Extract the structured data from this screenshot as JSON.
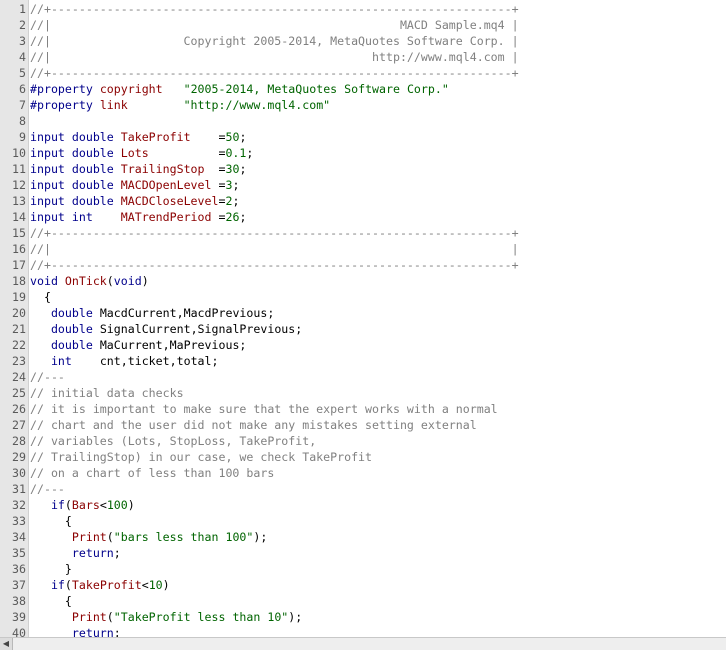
{
  "lines": [
    {
      "n": "1",
      "tokens": [
        {
          "t": "cm",
          "v": "//+------------------------------------------------------------------+"
        }
      ]
    },
    {
      "n": "2",
      "tokens": [
        {
          "t": "cm",
          "v": "//|                                                  MACD Sample.mq4 |"
        }
      ]
    },
    {
      "n": "3",
      "tokens": [
        {
          "t": "cm",
          "v": "//|                   Copyright 2005-2014, MetaQuotes Software Corp. |"
        }
      ]
    },
    {
      "n": "4",
      "tokens": [
        {
          "t": "cm",
          "v": "//|                                              http://www.mql4.com |"
        }
      ]
    },
    {
      "n": "5",
      "tokens": [
        {
          "t": "cm",
          "v": "//+------------------------------------------------------------------+"
        }
      ]
    },
    {
      "n": "6",
      "tokens": [
        {
          "t": "kw",
          "v": "#property"
        },
        {
          "t": "pl",
          "v": " "
        },
        {
          "t": "fn",
          "v": "copyright"
        },
        {
          "t": "pl",
          "v": "   "
        },
        {
          "t": "str",
          "v": "\"2005-2014, MetaQuotes Software Corp.\""
        }
      ]
    },
    {
      "n": "7",
      "tokens": [
        {
          "t": "kw",
          "v": "#property"
        },
        {
          "t": "pl",
          "v": " "
        },
        {
          "t": "fn",
          "v": "link"
        },
        {
          "t": "pl",
          "v": "        "
        },
        {
          "t": "str",
          "v": "\"http://www.mql4.com\""
        }
      ]
    },
    {
      "n": "8",
      "tokens": []
    },
    {
      "n": "9",
      "tokens": [
        {
          "t": "kw",
          "v": "input double"
        },
        {
          "t": "pl",
          "v": " "
        },
        {
          "t": "fn",
          "v": "TakeProfit"
        },
        {
          "t": "pl",
          "v": "    ="
        },
        {
          "t": "num",
          "v": "50"
        },
        {
          "t": "pl",
          "v": ";"
        }
      ]
    },
    {
      "n": "10",
      "tokens": [
        {
          "t": "kw",
          "v": "input double"
        },
        {
          "t": "pl",
          "v": " "
        },
        {
          "t": "fn",
          "v": "Lots"
        },
        {
          "t": "pl",
          "v": "          ="
        },
        {
          "t": "num",
          "v": "0.1"
        },
        {
          "t": "pl",
          "v": ";"
        }
      ]
    },
    {
      "n": "11",
      "tokens": [
        {
          "t": "kw",
          "v": "input double"
        },
        {
          "t": "pl",
          "v": " "
        },
        {
          "t": "fn",
          "v": "TrailingStop"
        },
        {
          "t": "pl",
          "v": "  ="
        },
        {
          "t": "num",
          "v": "30"
        },
        {
          "t": "pl",
          "v": ";"
        }
      ]
    },
    {
      "n": "12",
      "tokens": [
        {
          "t": "kw",
          "v": "input double"
        },
        {
          "t": "pl",
          "v": " "
        },
        {
          "t": "fn",
          "v": "MACDOpenLevel"
        },
        {
          "t": "pl",
          "v": " ="
        },
        {
          "t": "num",
          "v": "3"
        },
        {
          "t": "pl",
          "v": ";"
        }
      ]
    },
    {
      "n": "13",
      "tokens": [
        {
          "t": "kw",
          "v": "input double"
        },
        {
          "t": "pl",
          "v": " "
        },
        {
          "t": "fn",
          "v": "MACDCloseLevel"
        },
        {
          "t": "pl",
          "v": "="
        },
        {
          "t": "num",
          "v": "2"
        },
        {
          "t": "pl",
          "v": ";"
        }
      ]
    },
    {
      "n": "14",
      "tokens": [
        {
          "t": "kw",
          "v": "input int"
        },
        {
          "t": "pl",
          "v": "    "
        },
        {
          "t": "fn",
          "v": "MATrendPeriod"
        },
        {
          "t": "pl",
          "v": " ="
        },
        {
          "t": "num",
          "v": "26"
        },
        {
          "t": "pl",
          "v": ";"
        }
      ]
    },
    {
      "n": "15",
      "tokens": [
        {
          "t": "cm",
          "v": "//+------------------------------------------------------------------+"
        }
      ]
    },
    {
      "n": "16",
      "tokens": [
        {
          "t": "cm",
          "v": "//|                                                                  |"
        }
      ]
    },
    {
      "n": "17",
      "tokens": [
        {
          "t": "cm",
          "v": "//+------------------------------------------------------------------+"
        }
      ]
    },
    {
      "n": "18",
      "tokens": [
        {
          "t": "kw",
          "v": "void"
        },
        {
          "t": "pl",
          "v": " "
        },
        {
          "t": "fn",
          "v": "OnTick"
        },
        {
          "t": "pl",
          "v": "("
        },
        {
          "t": "kw",
          "v": "void"
        },
        {
          "t": "pl",
          "v": ")"
        }
      ]
    },
    {
      "n": "19",
      "tokens": [
        {
          "t": "pl",
          "v": "  {"
        }
      ]
    },
    {
      "n": "20",
      "tokens": [
        {
          "t": "pl",
          "v": "   "
        },
        {
          "t": "kw",
          "v": "double"
        },
        {
          "t": "pl",
          "v": " MacdCurrent,MacdPrevious;"
        }
      ]
    },
    {
      "n": "21",
      "tokens": [
        {
          "t": "pl",
          "v": "   "
        },
        {
          "t": "kw",
          "v": "double"
        },
        {
          "t": "pl",
          "v": " SignalCurrent,SignalPrevious;"
        }
      ]
    },
    {
      "n": "22",
      "tokens": [
        {
          "t": "pl",
          "v": "   "
        },
        {
          "t": "kw",
          "v": "double"
        },
        {
          "t": "pl",
          "v": " MaCurrent,MaPrevious;"
        }
      ]
    },
    {
      "n": "23",
      "tokens": [
        {
          "t": "pl",
          "v": "   "
        },
        {
          "t": "kw",
          "v": "int"
        },
        {
          "t": "pl",
          "v": "    cnt,ticket,total;"
        }
      ]
    },
    {
      "n": "24",
      "tokens": [
        {
          "t": "cm",
          "v": "//---"
        }
      ]
    },
    {
      "n": "25",
      "tokens": [
        {
          "t": "cm",
          "v": "// initial data checks"
        }
      ]
    },
    {
      "n": "26",
      "tokens": [
        {
          "t": "cm",
          "v": "// it is important to make sure that the expert works with a normal"
        }
      ]
    },
    {
      "n": "27",
      "tokens": [
        {
          "t": "cm",
          "v": "// chart and the user did not make any mistakes setting external"
        }
      ]
    },
    {
      "n": "28",
      "tokens": [
        {
          "t": "cm",
          "v": "// variables (Lots, StopLoss, TakeProfit,"
        }
      ]
    },
    {
      "n": "29",
      "tokens": [
        {
          "t": "cm",
          "v": "// TrailingStop) in our case, we check TakeProfit"
        }
      ]
    },
    {
      "n": "30",
      "tokens": [
        {
          "t": "cm",
          "v": "// on a chart of less than 100 bars"
        }
      ]
    },
    {
      "n": "31",
      "tokens": [
        {
          "t": "cm",
          "v": "//---"
        }
      ]
    },
    {
      "n": "32",
      "tokens": [
        {
          "t": "pl",
          "v": "   "
        },
        {
          "t": "kw",
          "v": "if"
        },
        {
          "t": "pl",
          "v": "("
        },
        {
          "t": "fn",
          "v": "Bars"
        },
        {
          "t": "pl",
          "v": "<"
        },
        {
          "t": "num",
          "v": "100"
        },
        {
          "t": "pl",
          "v": ")"
        }
      ]
    },
    {
      "n": "33",
      "tokens": [
        {
          "t": "pl",
          "v": "     {"
        }
      ]
    },
    {
      "n": "34",
      "tokens": [
        {
          "t": "pl",
          "v": "      "
        },
        {
          "t": "fn",
          "v": "Print"
        },
        {
          "t": "pl",
          "v": "("
        },
        {
          "t": "str",
          "v": "\"bars less than 100\""
        },
        {
          "t": "pl",
          "v": ");"
        }
      ]
    },
    {
      "n": "35",
      "tokens": [
        {
          "t": "pl",
          "v": "      "
        },
        {
          "t": "kw",
          "v": "return"
        },
        {
          "t": "pl",
          "v": ";"
        }
      ]
    },
    {
      "n": "36",
      "tokens": [
        {
          "t": "pl",
          "v": "     }"
        }
      ]
    },
    {
      "n": "37",
      "tokens": [
        {
          "t": "pl",
          "v": "   "
        },
        {
          "t": "kw",
          "v": "if"
        },
        {
          "t": "pl",
          "v": "("
        },
        {
          "t": "fn",
          "v": "TakeProfit"
        },
        {
          "t": "pl",
          "v": "<"
        },
        {
          "t": "num",
          "v": "10"
        },
        {
          "t": "pl",
          "v": ")"
        }
      ]
    },
    {
      "n": "38",
      "tokens": [
        {
          "t": "pl",
          "v": "     {"
        }
      ]
    },
    {
      "n": "39",
      "tokens": [
        {
          "t": "pl",
          "v": "      "
        },
        {
          "t": "fn",
          "v": "Print"
        },
        {
          "t": "pl",
          "v": "("
        },
        {
          "t": "str",
          "v": "\"TakeProfit less than 10\""
        },
        {
          "t": "pl",
          "v": ");"
        }
      ]
    },
    {
      "n": "40",
      "tokens": [
        {
          "t": "pl",
          "v": "      "
        },
        {
          "t": "kw",
          "v": "return"
        },
        {
          "t": "pl",
          "v": ";"
        }
      ]
    }
  ],
  "scrollbar": {
    "left_arrow_glyph": "◀"
  }
}
